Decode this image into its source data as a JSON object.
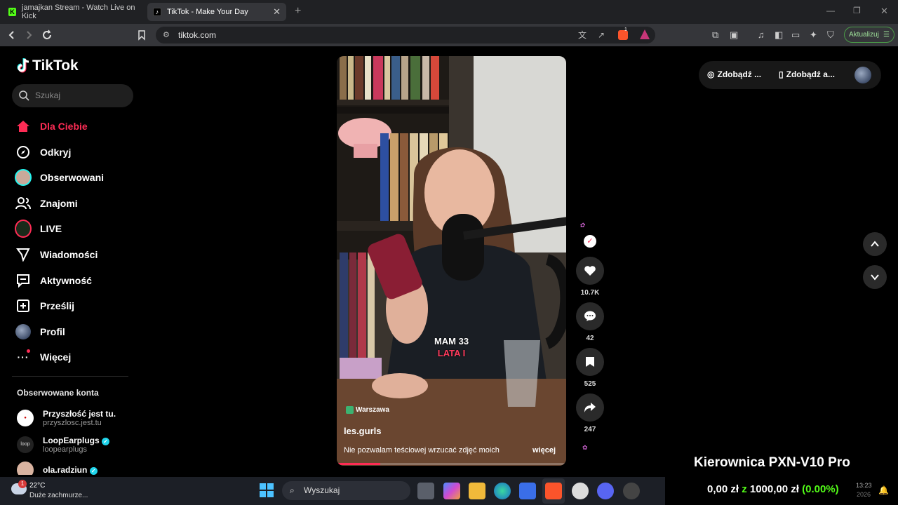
{
  "browser": {
    "tabs": [
      {
        "title": "jamajkan Stream - Watch Live on Kick",
        "active": false
      },
      {
        "title": "TikTok - Make Your Day",
        "active": true
      }
    ],
    "url": "tiktok.com",
    "update_label": "Aktualizuj",
    "shield_badge": "1"
  },
  "sidebar": {
    "logo": "TikTok",
    "search_placeholder": "Szukaj",
    "nav": [
      {
        "label": "Dla Ciebie",
        "icon": "home-icon",
        "active": true
      },
      {
        "label": "Odkryj",
        "icon": "compass-icon"
      },
      {
        "label": "Obserwowani",
        "icon": "avatar-icon"
      },
      {
        "label": "Znajomi",
        "icon": "friends-icon"
      },
      {
        "label": "LIVE",
        "icon": "live-icon"
      },
      {
        "label": "Wiadomości",
        "icon": "send-icon"
      },
      {
        "label": "Aktywność",
        "icon": "activity-icon"
      },
      {
        "label": "Prześlij",
        "icon": "upload-icon"
      },
      {
        "label": "Profil",
        "icon": "profile-icon"
      },
      {
        "label": "Więcej",
        "icon": "more-icon"
      }
    ],
    "following_title": "Obserwowane konta",
    "following": [
      {
        "name": "Przyszłość jest tu.",
        "handle": "przyszlosc.jest.tu",
        "verified": false
      },
      {
        "name": "LoopEarplugs",
        "handle": "loopearplugs",
        "verified": true
      },
      {
        "name": "ola.radziun",
        "handle": "",
        "verified": true
      }
    ]
  },
  "video": {
    "caption_line1": "MAM 33",
    "caption_line2": "LATA I",
    "location": "Warszawa",
    "author": "les.gurls",
    "description": "Nie pozwalam teściowej wrzucać zdjęć moich",
    "more": "więcej",
    "progress": 0.19
  },
  "actions": {
    "likes": "10.7K",
    "comments": "42",
    "saves": "525",
    "shares": "247"
  },
  "topright": {
    "btn1": "Zdobądź ...",
    "btn2": "Zdobądź a..."
  },
  "overlay_text": "Kierownica PXN-V10 Pro",
  "ticker": {
    "text1": "0,00 zł",
    "text2": "z",
    "text3": "1000,00 zł",
    "text4": "(0.00%)"
  },
  "taskbar": {
    "weather_temp": "22°C",
    "weather_desc": "Duże zachmurze...",
    "weather_badge": "1",
    "search_label": "Wyszukaj",
    "time": "13:23",
    "date": "2026"
  },
  "colors": {
    "accent": "#fe2c55",
    "bg": "#000000",
    "verified": "#20d5ec"
  }
}
